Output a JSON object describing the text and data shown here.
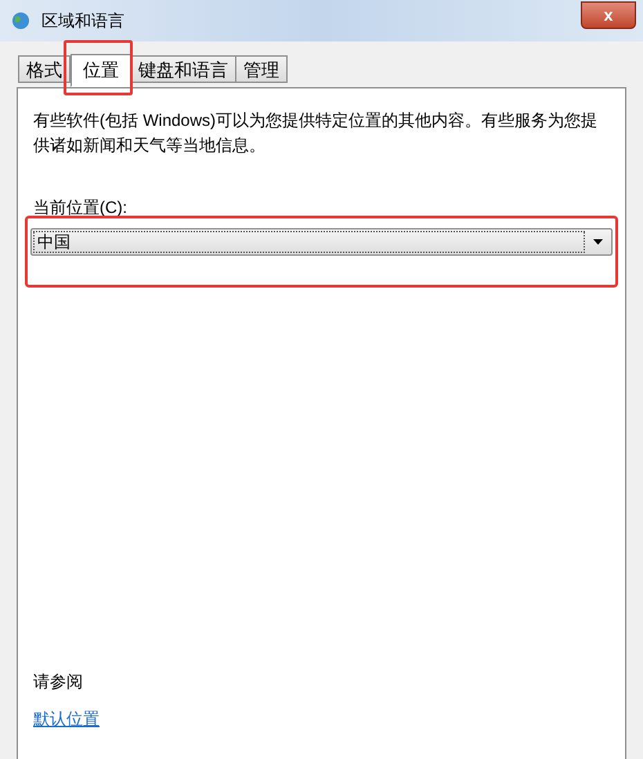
{
  "window": {
    "title": "区域和语言",
    "close": "x"
  },
  "tabs": [
    {
      "label": "格式",
      "selected": false
    },
    {
      "label": "位置",
      "selected": true,
      "highlighted": true
    },
    {
      "label": "键盘和语言",
      "selected": false
    },
    {
      "label": "管理",
      "selected": false
    }
  ],
  "description": "有些软件(包括 Windows)可以为您提供特定位置的其他内容。有些服务为您提供诸如新闻和天气等当地信息。",
  "location": {
    "label": "当前位置(C):",
    "value": "中国",
    "highlighted": true
  },
  "see_also": {
    "heading": "请参阅",
    "link": "默认位置"
  }
}
